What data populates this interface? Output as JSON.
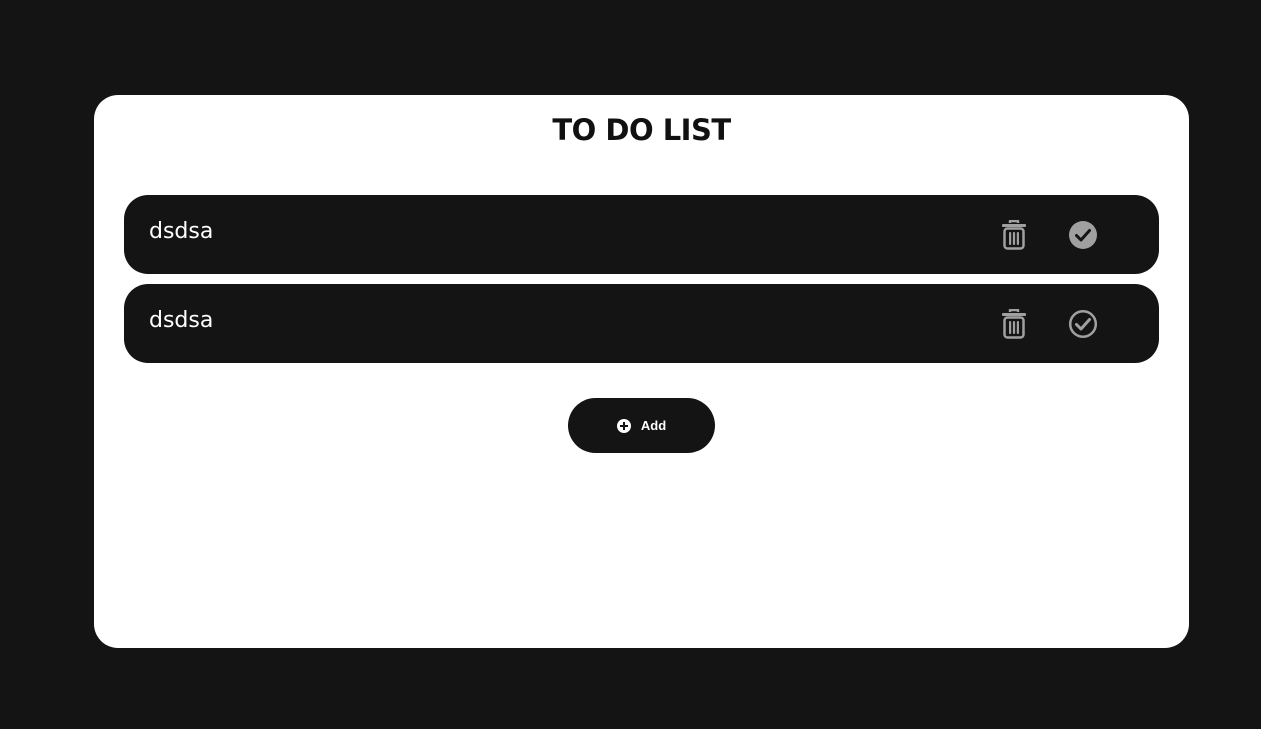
{
  "app": {
    "title": "TO DO LIST"
  },
  "todos": [
    {
      "text": "dsdsa",
      "completed": true
    },
    {
      "text": "dsdsa",
      "completed": false
    }
  ],
  "actions": {
    "add_label": "Add"
  },
  "icons": {
    "delete": "trash-icon",
    "complete": "check-circle-icon",
    "add": "plus-circle-icon"
  },
  "colors": {
    "background": "#141414",
    "card": "#ffffff",
    "item": "#141414",
    "icon": "#a0a0a0"
  }
}
